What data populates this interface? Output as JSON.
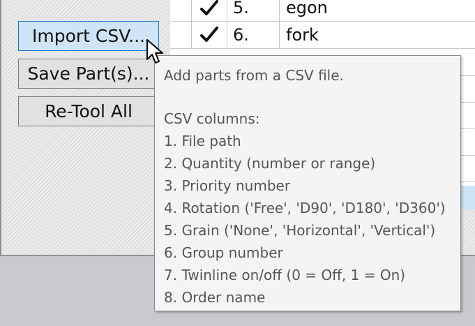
{
  "buttons": {
    "import_csv": "Import CSV...",
    "save_parts": "Save Part(s)...",
    "retool_all": "Re-Tool All"
  },
  "parts_rows": [
    {
      "checked": true,
      "number": "5.",
      "name": "egon"
    },
    {
      "checked": true,
      "number": "6.",
      "name": "fork"
    }
  ],
  "tooltip": {
    "summary": "Add parts from a CSV file.",
    "columns_heading": "CSV columns:",
    "columns": [
      "1. File path",
      "2. Quantity (number or range)",
      "3. Priority number",
      "4. Rotation ('Free', 'D90', 'D180', 'D360')",
      "5. Grain ('None', 'Horizontal', 'Vertical')",
      "6. Group number",
      "7. Twinline on/off (0 = Off, 1 = On)",
      "8. Order name"
    ]
  },
  "colors": {
    "active_button_fill": "#cfe5f7",
    "active_button_border": "#1a76c9",
    "selection": "#cde4f7"
  },
  "icons": {
    "checkmark": "check-icon",
    "cursor": "mouse-pointer-icon"
  }
}
